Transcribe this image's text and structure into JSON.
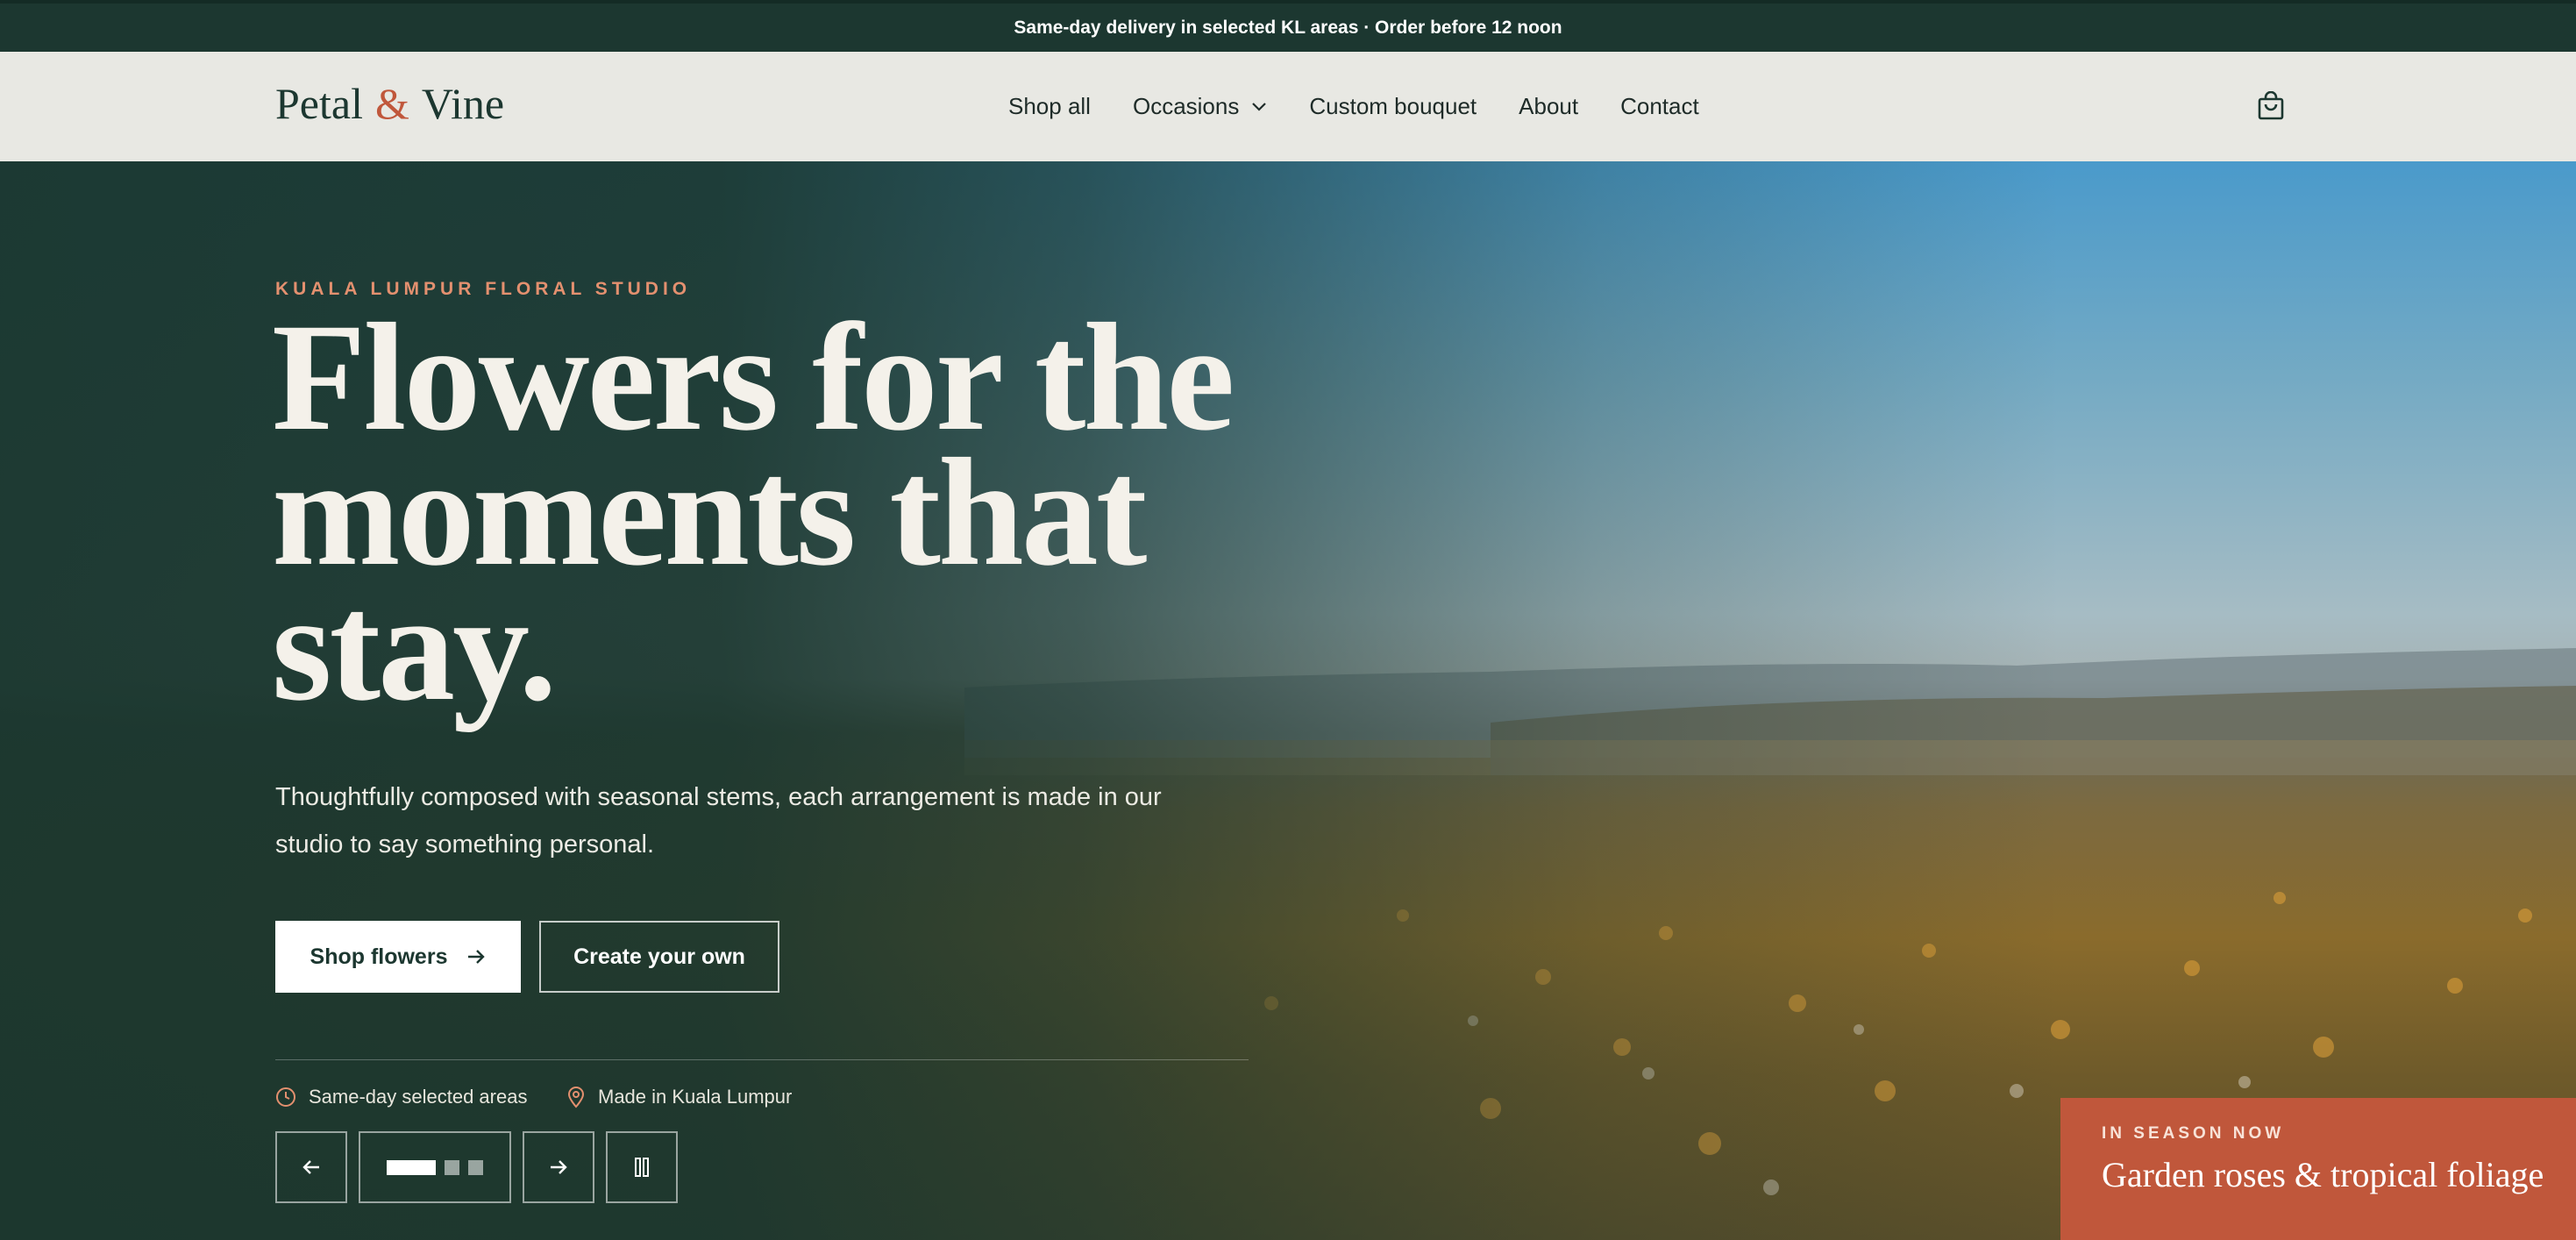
{
  "announcement": {
    "text": "Same-day delivery in selected KL areas · Order before 12 noon"
  },
  "header": {
    "logo": {
      "part1": "Petal",
      "amp": "&",
      "part2": "Vine"
    },
    "nav": [
      {
        "label": "Shop all"
      },
      {
        "label": "Occasions",
        "has_dropdown": true
      },
      {
        "label": "Custom bouquet"
      },
      {
        "label": "About"
      },
      {
        "label": "Contact"
      }
    ],
    "cart_icon": "shopping-bag-icon"
  },
  "hero": {
    "eyebrow": "KUALA LUMPUR FLORAL STUDIO",
    "headline": "Flowers for the moments that stay.",
    "subtext": "Thoughtfully composed with seasonal stems, each arrangement is made in our studio to say something personal.",
    "primary_cta": "Shop flowers",
    "secondary_cta": "Create your own",
    "features": [
      {
        "icon": "clock-icon",
        "label": "Same-day selected areas"
      },
      {
        "icon": "map-pin-icon",
        "label": "Made in Kuala Lumpur"
      }
    ],
    "carousel": {
      "slide_count": 3,
      "active_index": 0
    }
  },
  "season_card": {
    "label": "IN SEASON NOW",
    "title": "Garden roses & tropical foliage"
  },
  "colors": {
    "forest": "#1c3730",
    "terracotta": "#c0573b",
    "cream": "#e8e8e3",
    "eyebrow": "#e3906f"
  }
}
